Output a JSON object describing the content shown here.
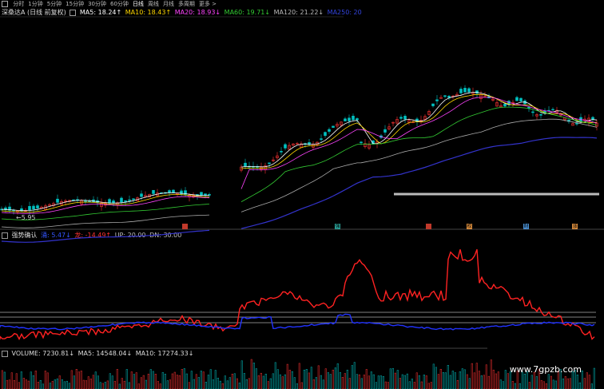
{
  "toolbar": {
    "items": [
      "分时",
      "1分钟",
      "5分钟",
      "15分钟",
      "30分钟",
      "60分钟",
      "日线",
      "周线",
      "月线",
      "多周期",
      "更多 >"
    ],
    "active": "日线"
  },
  "main_legend": {
    "title": "深桑达A (日线 前复权)",
    "ma5": "MA5: 18.24↑",
    "ma10": "MA10: 18.43↑",
    "ma20": "MA20: 18.93↓",
    "ma60": "MA60: 19.71↓",
    "ma120": "MA120: 21.22↓",
    "ma250": "MA250: 20"
  },
  "low_label": "←5.95",
  "ind_legend": {
    "title": "强势确认",
    "bull": "涌: 5.47↓",
    "bear": "龙: -14.49↑",
    "up": "UP: 20.00",
    "dn": "DN: 30.00"
  },
  "vol_legend": {
    "volume": "VOLUME: 7230.81↓",
    "ma5": "MA5: 14548.04↓",
    "ma10": "MA10: 17274.33↓"
  },
  "markers": [
    {
      "label": "",
      "color": "#c0392b"
    },
    {
      "label": "强",
      "color": "#2aa198"
    },
    {
      "label": "",
      "color": "#c0392b"
    },
    {
      "label": "权",
      "color": "#d98c3c"
    },
    {
      "label": "财",
      "color": "#4a8fd1"
    },
    {
      "label": "涨",
      "color": "#d98c3c"
    }
  ],
  "colors": {
    "ma5": "#ffffff",
    "ma10": "#ffd700",
    "ma20": "#ff44ff",
    "ma60": "#33cc33",
    "ma120": "#aaaaaa",
    "ma250": "#3333cc",
    "up": "#ff3333",
    "down": "#00c0c0",
    "bull": "#2233ff",
    "bear": "#ff2222"
  },
  "watermark": "www.7gpzb.com"
}
